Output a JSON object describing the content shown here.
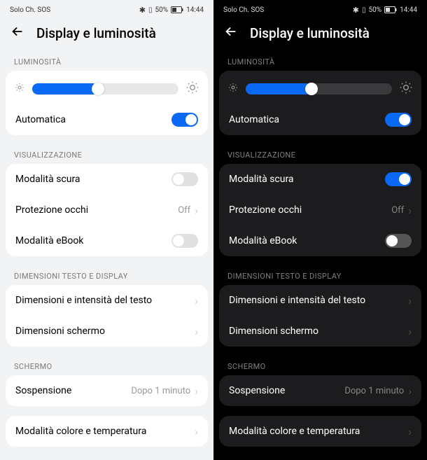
{
  "status": {
    "carrier": "Solo Ch. SOS",
    "battery_pct": "50%",
    "time": "14:44"
  },
  "header": {
    "title": "Display e luminosità"
  },
  "sections": {
    "brightness": {
      "label": "LUMINOSITÀ",
      "slider_pct": 45,
      "auto_label": "Automatica",
      "auto_on": true
    },
    "visualization": {
      "label": "VISUALIZZAZIONE",
      "dark_mode_label": "Modalità scura",
      "dark_mode_on_light": false,
      "dark_mode_on_dark": true,
      "eye_protect_label": "Protezione occhi",
      "eye_protect_value": "Off",
      "ebook_label": "Modalità eBook",
      "ebook_on": false
    },
    "text_display": {
      "label": "DIMENSIONI TESTO E DISPLAY",
      "text_size_label": "Dimensioni e intensità del testo",
      "screen_size_label": "Dimensioni schermo"
    },
    "screen": {
      "label": "SCHERMO",
      "sleep_label": "Sospensione",
      "sleep_value": "Dopo 1 minuto",
      "color_temp_label": "Modalità colore e temperatura"
    }
  }
}
